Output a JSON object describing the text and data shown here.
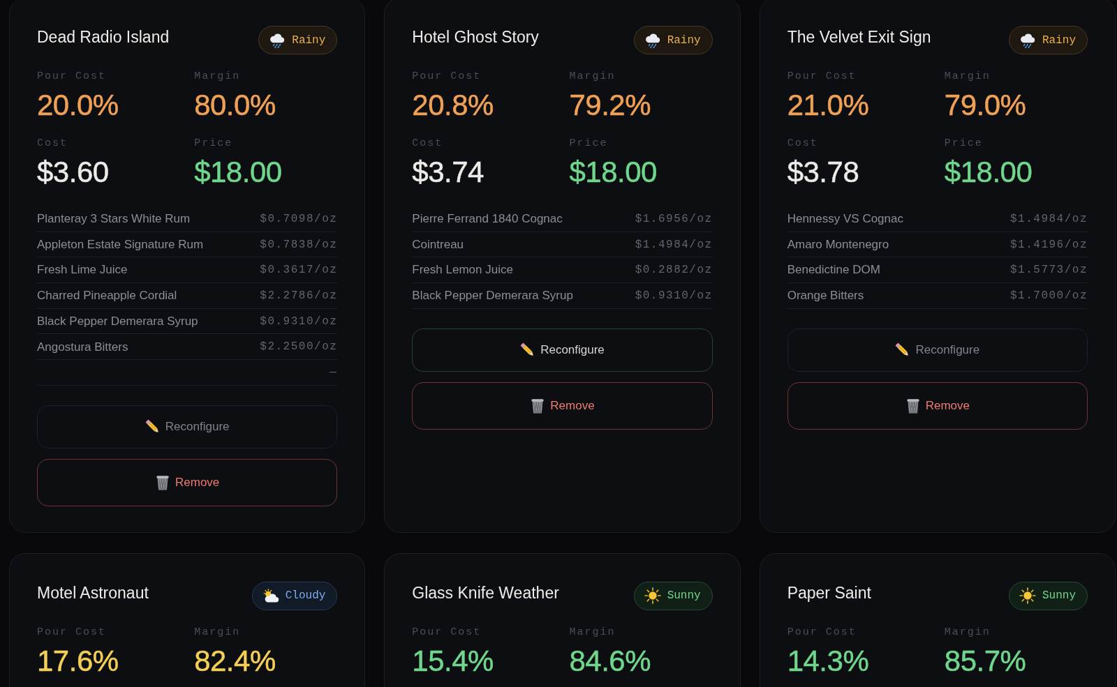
{
  "cards": [
    {
      "title": "Dead Radio Island",
      "weather": {
        "kind": "rainy",
        "label": "Rainy"
      },
      "metrics": [
        {
          "label": "Pour Cost",
          "value": "20.0%",
          "color": "#f0a155"
        },
        {
          "label": "Margin",
          "value": "80.0%",
          "color": "#f0a155"
        },
        {
          "label": "Cost",
          "value": "$3.60",
          "color": "#ecebe8"
        },
        {
          "label": "Price",
          "value": "$18.00",
          "color": "#6fd68c"
        }
      ],
      "ingredients": [
        {
          "name": "Planteray 3 Stars White Rum",
          "cost": "$0.7098/oz"
        },
        {
          "name": "Appleton Estate Signature Rum",
          "cost": "$0.7838/oz"
        },
        {
          "name": "Fresh Lime Juice",
          "cost": "$0.3617/oz"
        },
        {
          "name": "Charred Pineapple Cordial",
          "cost": "$2.2786/oz"
        },
        {
          "name": "Black Pepper Demerara Syrup",
          "cost": "$0.9310/oz"
        },
        {
          "name": "Angostura Bitters",
          "cost": "$2.2500/oz"
        },
        {
          "cost": "—"
        }
      ],
      "actions": [
        {
          "kind": "reconfigure",
          "label": "Reconfigure",
          "hovered": false
        },
        {
          "kind": "remove",
          "label": "Remove",
          "hovered": false
        }
      ]
    },
    {
      "title": "Hotel Ghost Story",
      "weather": {
        "kind": "rainy",
        "label": "Rainy"
      },
      "metrics": [
        {
          "label": "Pour Cost",
          "value": "20.8%",
          "color": "#f0a155"
        },
        {
          "label": "Margin",
          "value": "79.2%",
          "color": "#f0a155"
        },
        {
          "label": "Cost",
          "value": "$3.74",
          "color": "#ecebe8"
        },
        {
          "label": "Price",
          "value": "$18.00",
          "color": "#6fd68c"
        }
      ],
      "ingredients": [
        {
          "name": "Pierre Ferrand 1840 Cognac",
          "cost": "$1.6956/oz"
        },
        {
          "name": "Cointreau",
          "cost": "$1.4984/oz"
        },
        {
          "name": "Fresh Lemon Juice",
          "cost": "$0.2882/oz"
        },
        {
          "name": "Black Pepper Demerara Syrup",
          "cost": "$0.9310/oz"
        }
      ],
      "actions": [
        {
          "kind": "reconfigure",
          "label": "Reconfigure",
          "hovered": true
        },
        {
          "kind": "remove",
          "label": "Remove",
          "hovered": false
        }
      ]
    },
    {
      "title": "The Velvet Exit Sign",
      "weather": {
        "kind": "rainy",
        "label": "Rainy"
      },
      "metrics": [
        {
          "label": "Pour Cost",
          "value": "21.0%",
          "color": "#f0a155"
        },
        {
          "label": "Margin",
          "value": "79.0%",
          "color": "#f0a155"
        },
        {
          "label": "Cost",
          "value": "$3.78",
          "color": "#ecebe8"
        },
        {
          "label": "Price",
          "value": "$18.00",
          "color": "#6fd68c"
        }
      ],
      "ingredients": [
        {
          "name": "Hennessy VS Cognac",
          "cost": "$1.4984/oz"
        },
        {
          "name": "Amaro Montenegro",
          "cost": "$1.4196/oz"
        },
        {
          "name": "Benedictine DOM",
          "cost": "$1.5773/oz"
        },
        {
          "name": "Orange Bitters",
          "cost": "$1.7000/oz"
        }
      ],
      "actions": [
        {
          "kind": "reconfigure",
          "label": "Reconfigure",
          "hovered": false
        },
        {
          "kind": "remove",
          "label": "Remove",
          "hovered": false
        }
      ]
    },
    {
      "title": "Motel Astronaut",
      "weather": {
        "kind": "cloudy",
        "label": "Cloudy"
      },
      "metrics": [
        {
          "label": "Pour Cost",
          "value": "17.6%",
          "color": "#f4cf55"
        },
        {
          "label": "Margin",
          "value": "82.4%",
          "color": "#f4cf55"
        }
      ]
    },
    {
      "title": "Glass Knife Weather",
      "weather": {
        "kind": "sunny",
        "label": "Sunny"
      },
      "metrics": [
        {
          "label": "Pour Cost",
          "value": "15.4%",
          "color": "#6fd68c"
        },
        {
          "label": "Margin",
          "value": "84.6%",
          "color": "#6fd68c"
        }
      ]
    },
    {
      "title": "Paper Saint",
      "weather": {
        "kind": "sunny",
        "label": "Sunny"
      },
      "metrics": [
        {
          "label": "Pour Cost",
          "value": "14.3%",
          "color": "#6fd68c"
        },
        {
          "label": "Margin",
          "value": "85.7%",
          "color": "#6fd68c"
        }
      ]
    }
  ]
}
